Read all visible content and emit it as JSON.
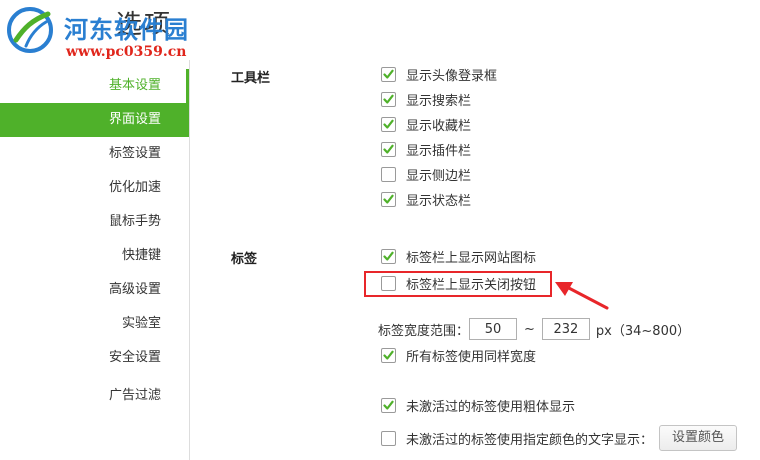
{
  "window": {
    "title": "选项"
  },
  "watermark": {
    "name": "河东软件园",
    "url": "www.pc0359.cn"
  },
  "colors": {
    "accent": "#4fb12a",
    "highlight": "#e8262a",
    "watermark_blue": "#2a7fd1",
    "watermark_red": "#e0261c"
  },
  "sidebar": {
    "items": [
      {
        "label": "基本设置"
      },
      {
        "label": "界面设置"
      },
      {
        "label": "标签设置"
      },
      {
        "label": "优化加速"
      },
      {
        "label": "鼠标手势"
      },
      {
        "label": "快捷键"
      },
      {
        "label": "高级设置"
      },
      {
        "label": "实验室"
      },
      {
        "label": "安全设置"
      },
      {
        "label": "广告过滤"
      }
    ],
    "active": "界面设置"
  },
  "toolbar_section": {
    "title": "工具栏",
    "options": [
      {
        "label": "显示头像登录框",
        "checked": true
      },
      {
        "label": "显示搜索栏",
        "checked": true
      },
      {
        "label": "显示收藏栏",
        "checked": true
      },
      {
        "label": "显示插件栏",
        "checked": true
      },
      {
        "label": "显示侧边栏",
        "checked": false
      },
      {
        "label": "显示状态栏",
        "checked": true
      }
    ]
  },
  "tab_section": {
    "title": "标签",
    "options": [
      {
        "label": "标签栏上显示网站图标",
        "checked": true
      },
      {
        "label": "标签栏上显示关闭按钮",
        "checked": false
      }
    ],
    "width_label": "标签宽度范围：",
    "width_min": "50",
    "width_max": "232",
    "width_separator": "~",
    "width_unit": "px（34~800）",
    "same_width": {
      "label": "所有标签使用同样宽度",
      "checked": true
    },
    "bold_inactive": {
      "label": "未激活过的标签使用粗体显示",
      "checked": true
    },
    "color_inactive": {
      "label": "未激活过的标签使用指定颜色的文字显示：",
      "checked": false
    },
    "color_button": "设置颜色"
  }
}
